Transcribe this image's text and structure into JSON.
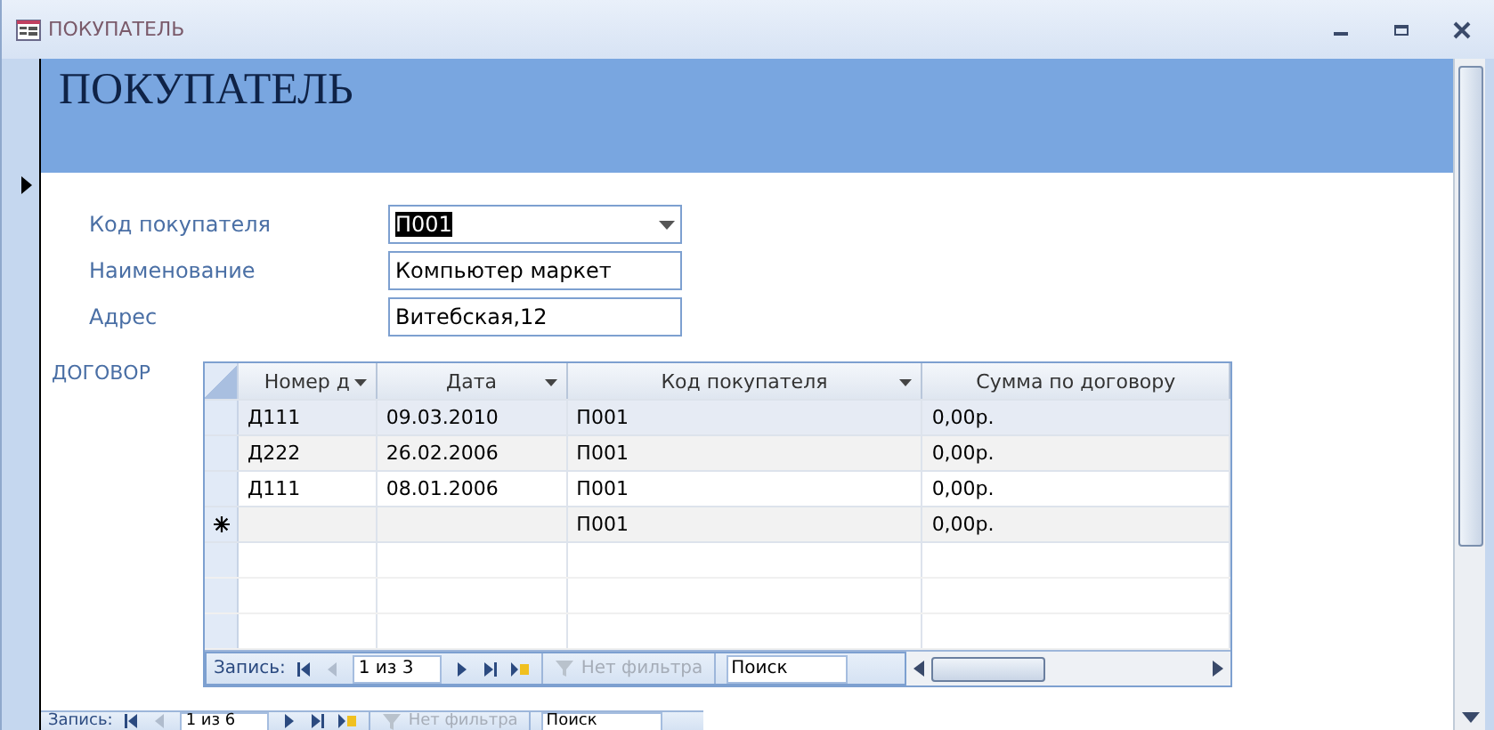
{
  "window": {
    "title": "ПОКУПАТЕЛЬ"
  },
  "form_header": {
    "title": "ПОКУПАТЕЛЬ"
  },
  "fields": [
    {
      "label": "Код покупателя",
      "value": "П001",
      "kind": "combo",
      "highlighted": true
    },
    {
      "label": "Наименование",
      "value": "Компьютер маркет",
      "kind": "text",
      "highlighted": false
    },
    {
      "label": "Адрес",
      "value": "Витебская,12",
      "kind": "text",
      "highlighted": false
    }
  ],
  "subform": {
    "label": "ДОГОВОР",
    "columns": [
      {
        "label": "Номер д",
        "has_menu": true
      },
      {
        "label": "Дата",
        "has_menu": true
      },
      {
        "label": "Код покупателя",
        "has_menu": true
      },
      {
        "label": "Сумма по договору",
        "has_menu": false
      }
    ],
    "rows": [
      {
        "kind": "record",
        "selected": true,
        "cells": [
          "Д111",
          "09.03.2010",
          "П001",
          "0,00р."
        ]
      },
      {
        "kind": "record",
        "selected": false,
        "cells": [
          "Д222",
          "26.02.2006",
          "П001",
          "0,00р."
        ]
      },
      {
        "kind": "record",
        "selected": false,
        "cells": [
          "Д111",
          "08.01.2006",
          "П001",
          "0,00р."
        ]
      },
      {
        "kind": "new",
        "selected": false,
        "cells": [
          "",
          "",
          "П001",
          "0,00р."
        ]
      }
    ],
    "navigation": {
      "label": "Запись:",
      "position": "1 из 3",
      "filter": "Нет фильтра",
      "search": "Поиск"
    }
  },
  "navigation": {
    "label": "Запись:",
    "position": "1 из 6",
    "filter": "Нет фильтра",
    "search": "Поиск"
  }
}
